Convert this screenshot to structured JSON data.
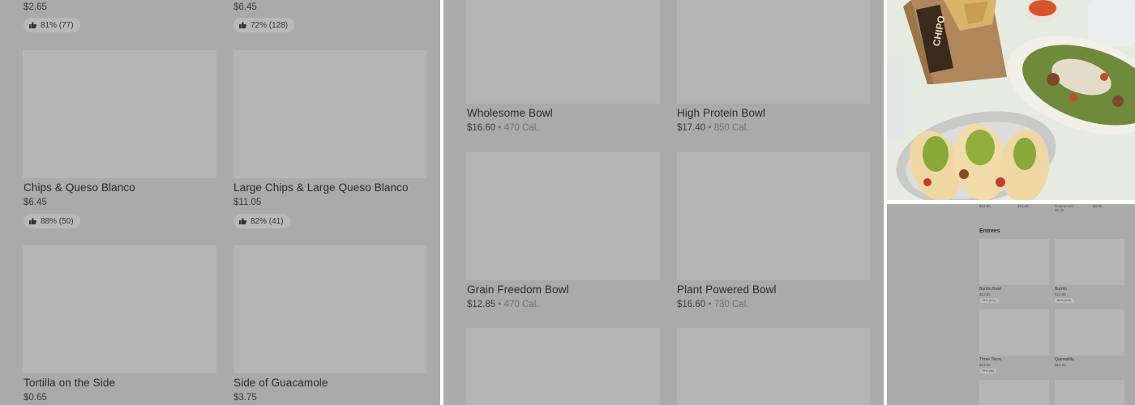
{
  "panel_a": {
    "top_row": [
      {
        "price": "$2.65",
        "rating": "81% (77)"
      },
      {
        "price": "$6.45",
        "rating": "72% (128)"
      }
    ],
    "items": [
      {
        "name": "Chips & Queso Blanco",
        "price": "$6.45",
        "rating": "88% (50)"
      },
      {
        "name": "Large Chips & Large Queso Blanco",
        "price": "$11.05",
        "rating": "82% (41)"
      },
      {
        "name": "Tortilla on the Side",
        "price": "$0.65"
      },
      {
        "name": "Side of Guacamole",
        "price": "$3.75"
      }
    ]
  },
  "panel_b": {
    "items": [
      {
        "name": "Wholesome Bowl",
        "price": "$16.60",
        "calories": "470 Cal."
      },
      {
        "name": "High Protein Bowl",
        "price": "$17.40",
        "calories": "850 Cal."
      },
      {
        "name": "Grain Freedom Bowl",
        "price": "$12.85",
        "calories": "470 Cal."
      },
      {
        "name": "Plant Powered Bowl",
        "price": "$16.60",
        "calories": "730 Cal."
      }
    ],
    "separator": "•"
  },
  "panel_c": {
    "photo": {
      "bag_text": "CHIPO"
    },
    "mini": {
      "top_prices": [
        "$12.85",
        "$12.85",
        "Guacamole",
        "$2.95"
      ],
      "top_sub": "$6.45",
      "section_title": "Entrees",
      "items": [
        {
          "name": "Burrito Bowl",
          "price": "$12.85",
          "rating": "79% (374)"
        },
        {
          "name": "Burrito",
          "price": "$12.85",
          "rating": "80% (249)"
        },
        {
          "name": "Three Tacos",
          "price": "$12.85",
          "rating": "79% (98)"
        },
        {
          "name": "Quesadilla",
          "price": "$13.60"
        }
      ]
    }
  },
  "icons": {
    "rating": "thumbs-up-icon"
  },
  "colors": {
    "overlay": "#aaaaaa",
    "placeholder": "#b5b5b5",
    "pill": "#b9b9b9"
  }
}
